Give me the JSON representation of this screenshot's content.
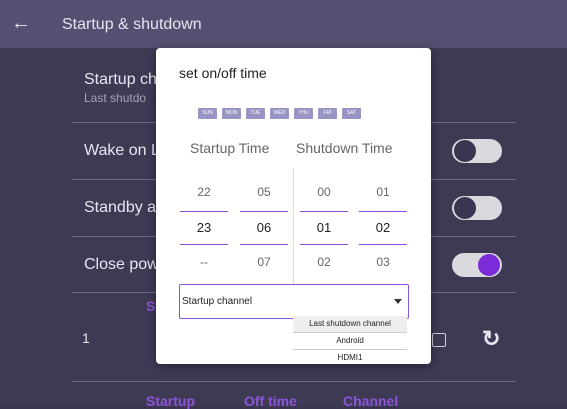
{
  "header": {
    "title": "Startup & shutdown"
  },
  "settings": {
    "startup_channel": {
      "label": "Startup ch",
      "sub": "Last shutdo"
    },
    "wake_on_lan": {
      "label": "Wake on L",
      "on": false
    },
    "standby": {
      "label": "Standby a",
      "on": false
    },
    "close_power": {
      "label": "Close pow",
      "on": true
    },
    "section_label": "St",
    "schedule_index": "1",
    "footer_cols": [
      "Startup",
      "Off time",
      "Channel"
    ]
  },
  "dialog": {
    "title": "set on/off time",
    "days": [
      "SUN",
      "MON",
      "TUE",
      "WED",
      "THU",
      "FRI",
      "SAT"
    ],
    "startup_time_label": "Startup Time",
    "shutdown_time_label": "Shutdown Time",
    "startup_hours": [
      "22",
      "23",
      "--"
    ],
    "startup_minutes": [
      "05",
      "06",
      "07"
    ],
    "shutdown_hours": [
      "00",
      "01",
      "02"
    ],
    "shutdown_minutes": [
      "01",
      "02",
      "03"
    ],
    "channel_dropdown_label": "Startup channel",
    "channel_options": [
      "Last shutdown channel",
      "Android",
      "HDMI1"
    ]
  },
  "colors": {
    "accent": "#8c55d9",
    "toggle_on": "#7c2bd8",
    "header": "#545072",
    "background": "#3e3a54"
  }
}
